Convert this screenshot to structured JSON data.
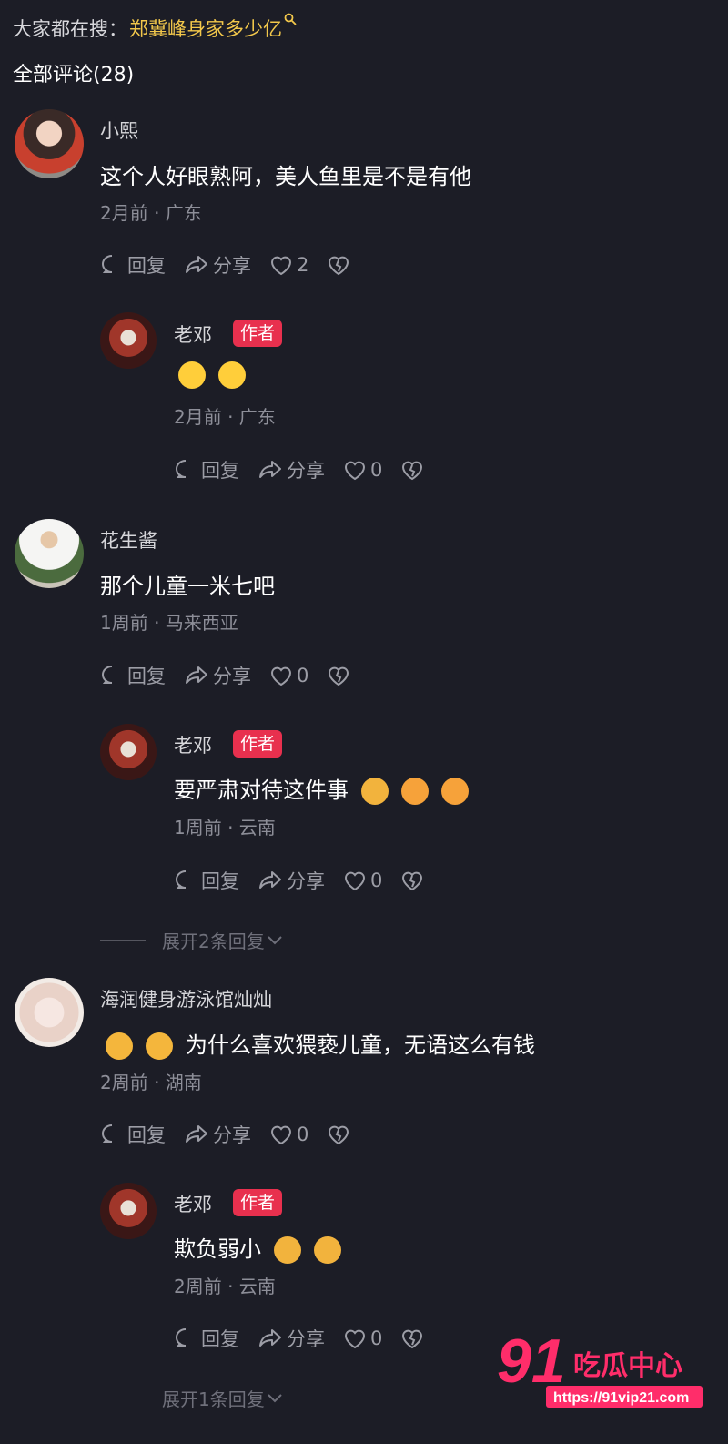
{
  "search": {
    "prefix": "大家都在搜：",
    "term": "郑冀峰身家多少亿"
  },
  "comments_title": "全部评论(28)",
  "actions": {
    "reply": "回复",
    "share": "分享"
  },
  "comments": [
    {
      "user": "小熙",
      "text": "这个人好眼熟阿，美人鱼里是不是有他",
      "time": "2月前 · 广东",
      "likes": "2",
      "replies": [
        {
          "user": "老邓",
          "tag": "作者",
          "emojis": [
            "grin-sweat",
            "grin-sweat"
          ],
          "text": "",
          "time": "2月前 · 广东",
          "likes": "0"
        }
      ]
    },
    {
      "user": "花生酱",
      "text": "那个儿童一米七吧",
      "time": "1周前 · 马来西亚",
      "likes": "0",
      "replies": [
        {
          "user": "老邓",
          "tag": "作者",
          "text": "要严肃对待这件事",
          "emojis_after": [
            "pray",
            "thumbs-up",
            "thumbs-up"
          ],
          "time": "1周前 · 云南",
          "likes": "0"
        }
      ],
      "expand": "展开2条回复"
    },
    {
      "user": "海润健身游泳馆灿灿",
      "emojis_before": [
        "cat",
        "cat"
      ],
      "text": "为什么喜欢猥亵儿童，无语这么有钱",
      "time": "2周前 · 湖南",
      "likes": "0",
      "replies": [
        {
          "user": "老邓",
          "tag": "作者",
          "text": "欺负弱小",
          "emojis_after": [
            "pray",
            "pray"
          ],
          "time": "2周前 · 云南",
          "likes": "0"
        }
      ],
      "expand": "展开1条回复"
    }
  ],
  "watermark": {
    "logo": "91吃瓜中心",
    "url": "https://91vip21.com"
  },
  "colors": {
    "background": "#1c1d26",
    "search_term": "#f3c84b",
    "author_tag": "#e8304e",
    "watermark": "#ff2d6a"
  }
}
